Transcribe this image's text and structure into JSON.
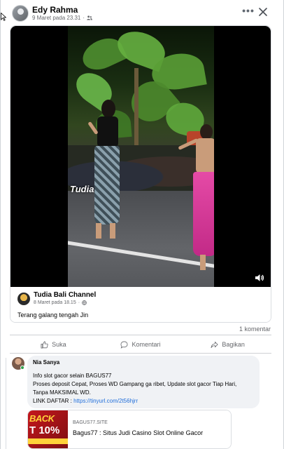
{
  "post": {
    "author": "Edy Rahma",
    "timestamp": "9 Maret pada 23.31",
    "audience_icon": "friends-icon",
    "more_icon": "more-horizontal-icon",
    "more_glyph": "•••",
    "close_icon": "close-icon"
  },
  "shared": {
    "video_watermark": "Tudia",
    "volume_icon": "volume-icon",
    "channel_name": "Tudia Bali Channel",
    "channel_timestamp": "8 Maret pada 18.15",
    "channel_audience_icon": "globe-icon",
    "caption": "Terang galang tengah Jin"
  },
  "stats": {
    "comment_count": "1 komentar"
  },
  "actions": [
    {
      "label": "Suka",
      "icon": "like-icon"
    },
    {
      "label": "Komentari",
      "icon": "comment-icon"
    },
    {
      "label": "Bagikan",
      "icon": "share-icon"
    }
  ],
  "comment": {
    "author": "Nia Sanya",
    "lines": [
      "Info slot gacor selain BAGUS77",
      "Proses deposit Cepat, Proses WD Gampang ga ribet, Update slot gacor Tiap Hari,",
      "Tanpa MAKSIMAL WD.",
      "LINK DAFTAR : "
    ],
    "link": "https://tinyurl.com/2t56hjrr",
    "preview": {
      "thumb_text_top": "BACK",
      "thumb_text_bottom": "T 10%",
      "domain": "BAGUS77.SITE",
      "title": "Bagus77 : Situs Judi Casino Slot Online Gacor",
      "info_icon": "info-icon"
    }
  },
  "colors": {
    "link": "#216fdb",
    "muted": "#65676b",
    "bubble": "#f0f2f5",
    "online": "#31a24c"
  }
}
